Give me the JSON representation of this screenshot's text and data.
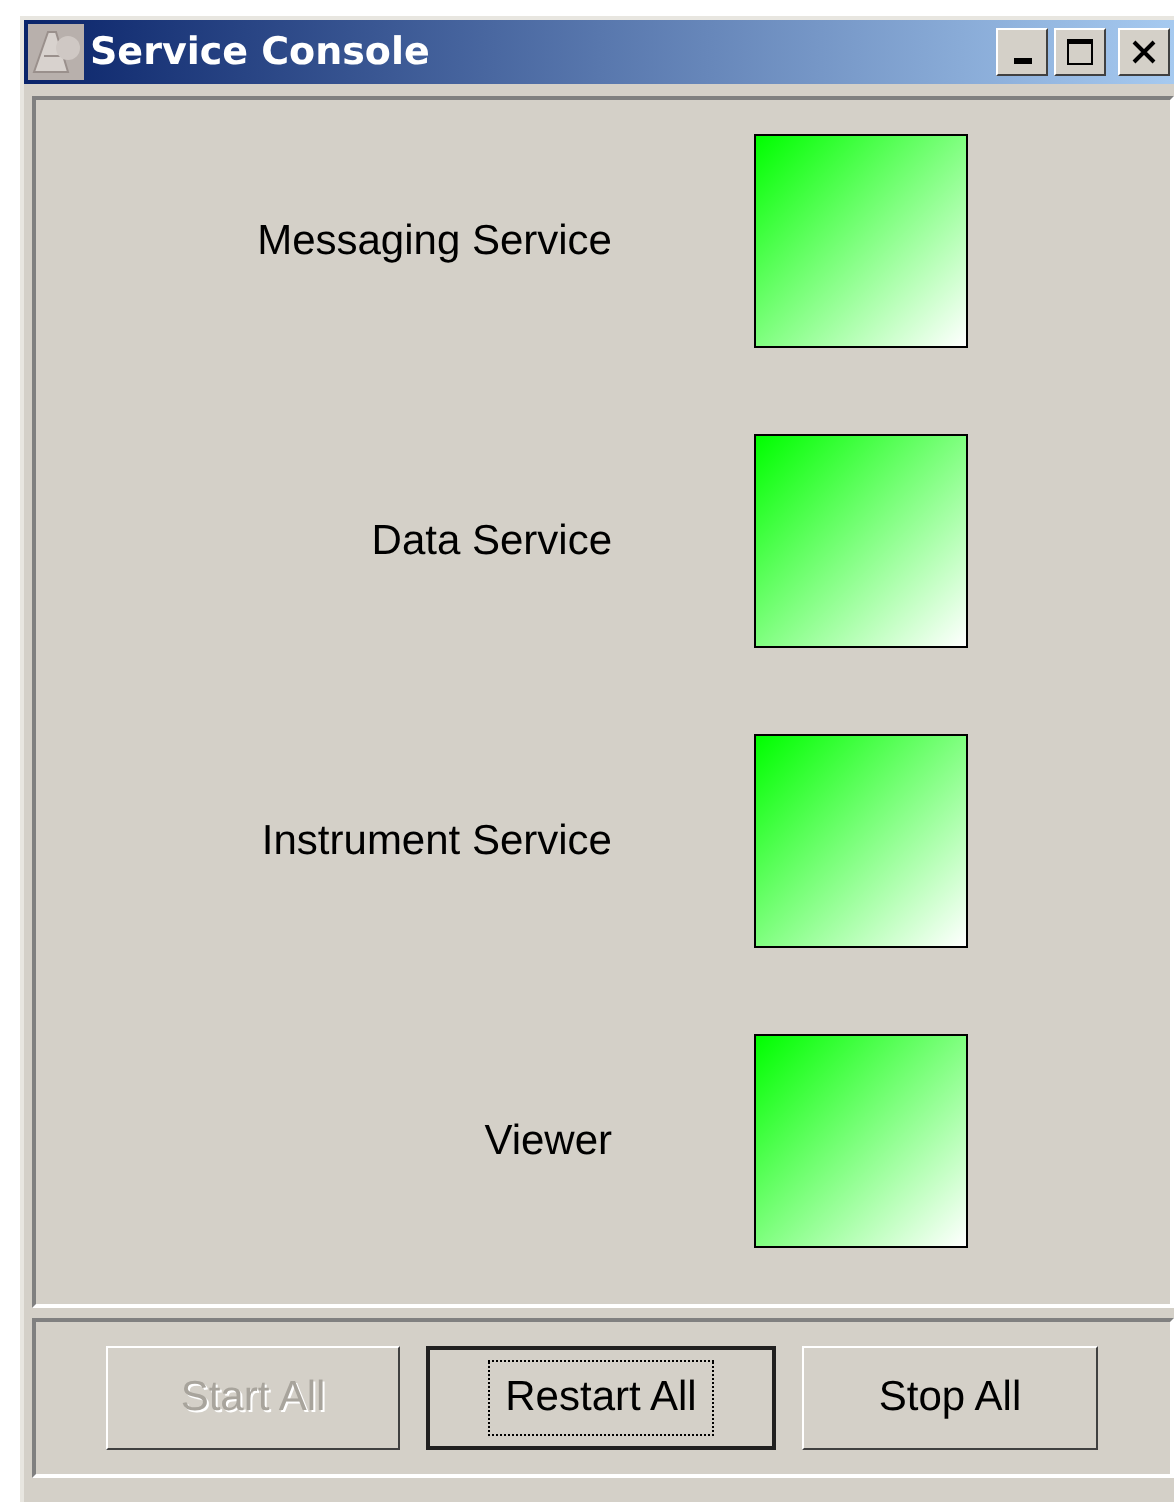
{
  "window": {
    "title": "Service Console"
  },
  "services": [
    {
      "name": "Messaging Service",
      "running": true
    },
    {
      "name": "Data Service",
      "running": true
    },
    {
      "name": "Instrument Service",
      "running": true
    },
    {
      "name": "Viewer",
      "running": true
    }
  ],
  "buttons": [
    {
      "label": "Start All",
      "disabled": true,
      "focused": false
    },
    {
      "label": "Restart All",
      "disabled": false,
      "focused": true
    },
    {
      "label": "Stop All",
      "disabled": false,
      "focused": false
    }
  ]
}
